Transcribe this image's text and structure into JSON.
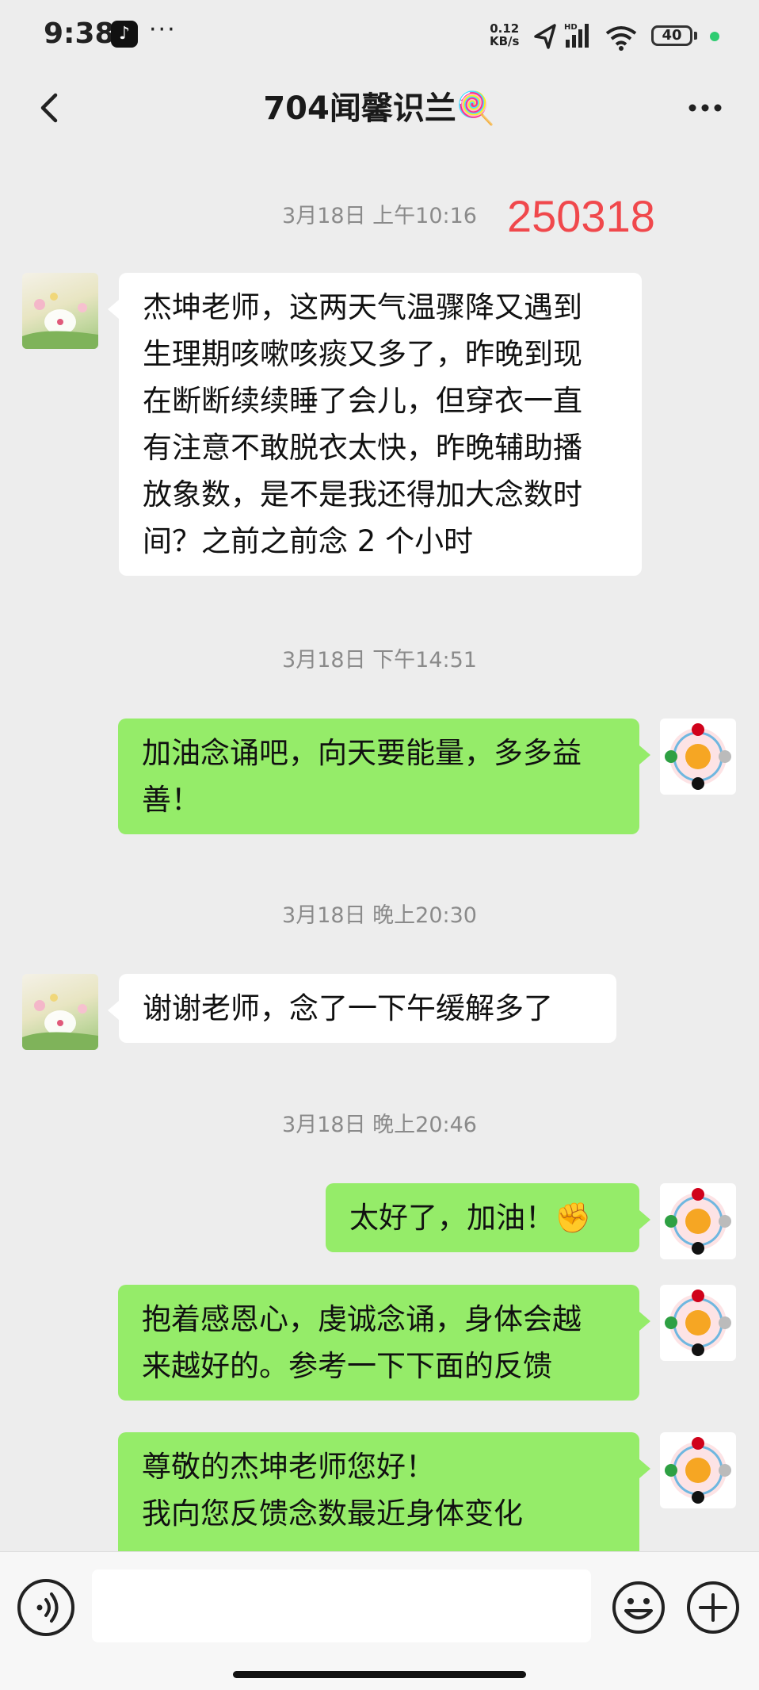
{
  "status_bar": {
    "time": "9:38",
    "net_speed_top": "0.12",
    "net_speed_bottom": "KB/s",
    "battery": "40",
    "hd": "HD"
  },
  "header": {
    "title": "704闻馨识兰🍭"
  },
  "chat": {
    "annotation": "250318",
    "timestamps": [
      "3月18日 上午10:16",
      "3月18日 下午14:51",
      "3月18日 晚上20:30",
      "3月18日 晚上20:46"
    ],
    "messages": [
      {
        "side": "left",
        "lines": [
          "杰坤老师，这两天气温骤降又遇到",
          "生理期咳嗽咳痰又多了，昨晚到现",
          "在断断续续睡了会儿，但穿衣一直",
          "有注意不敢脱衣太快，昨晚辅助播",
          "放象数，是不是我还得加大念数时",
          "间？之前之前念 2 个小时"
        ]
      },
      {
        "side": "right",
        "lines": [
          "加油念诵吧，向天要能量，多多益",
          "善！"
        ]
      },
      {
        "side": "left",
        "lines": [
          "谢谢老师，念了一下午缓解多了"
        ]
      },
      {
        "side": "right",
        "lines": [
          "太好了，加油！✊"
        ]
      },
      {
        "side": "right",
        "lines": [
          "抱着感恩心，虔诚念诵，身体会越",
          "来越好的。参考一下下面的反馈"
        ]
      },
      {
        "side": "right",
        "lines": [
          "尊敬的杰坤老师您好！",
          "我向您反馈念数最近身体变化"
        ]
      }
    ]
  },
  "colors": {
    "bubble_green": "#95ec69",
    "bubble_white": "#ffffff",
    "background": "#ededed",
    "annotation_red": "#f0484c"
  },
  "icons": {
    "back": "chevron-left-icon",
    "more": "more-dots-icon",
    "voice": "voice-icon",
    "emoji": "emoji-icon",
    "plus": "plus-icon"
  }
}
